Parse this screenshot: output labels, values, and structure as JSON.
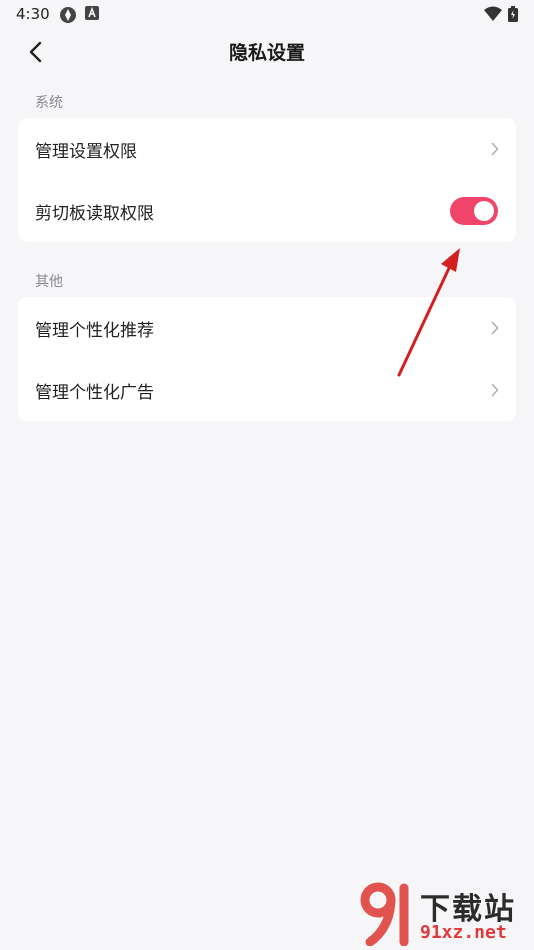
{
  "status_bar": {
    "time": "4:30",
    "icons": [
      "sync-icon",
      "a-badge-icon",
      "wifi-icon",
      "battery-icon"
    ]
  },
  "header": {
    "title": "隐私设置",
    "back_icon": "chevron-left-icon"
  },
  "sections": [
    {
      "label": "系统",
      "rows": [
        {
          "label": "管理设置权限",
          "control": "chevron"
        },
        {
          "label": "剪切板读取权限",
          "control": "toggle",
          "toggle_on": true
        }
      ]
    },
    {
      "label": "其他",
      "rows": [
        {
          "label": "管理个性化推荐",
          "control": "chevron"
        },
        {
          "label": "管理个性化广告",
          "control": "chevron"
        }
      ]
    }
  ],
  "colors": {
    "background": "#f6f6f8",
    "card": "#ffffff",
    "toggle_on": "#f0446a",
    "annotation_arrow": "#d41f1f"
  },
  "watermark": {
    "logo_text": "91",
    "title": "下载站",
    "url": "91xz.net"
  }
}
